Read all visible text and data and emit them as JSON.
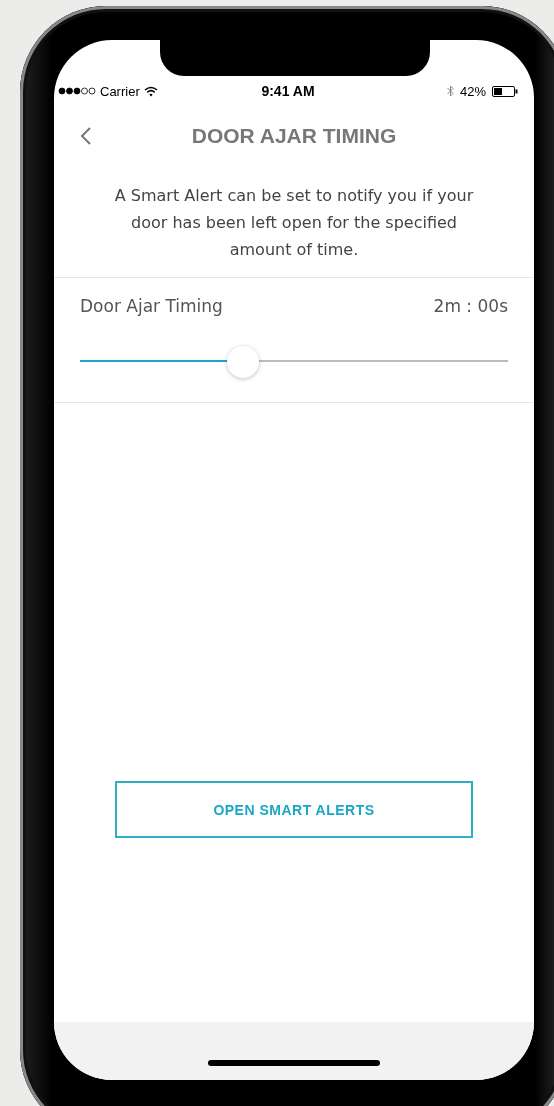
{
  "status_bar": {
    "carrier": "Carrier",
    "time": "9:41 AM",
    "battery": "42%"
  },
  "header": {
    "title": "DOOR AJAR TIMING"
  },
  "description": "A Smart Alert can be set to notify you if your door has been left open for the specified amount of time.",
  "setting": {
    "label": "Door Ajar Timing",
    "reading": "2m : 00s",
    "level": 0.38
  },
  "button": {
    "label": "OPEN SMART ALERTS"
  }
}
